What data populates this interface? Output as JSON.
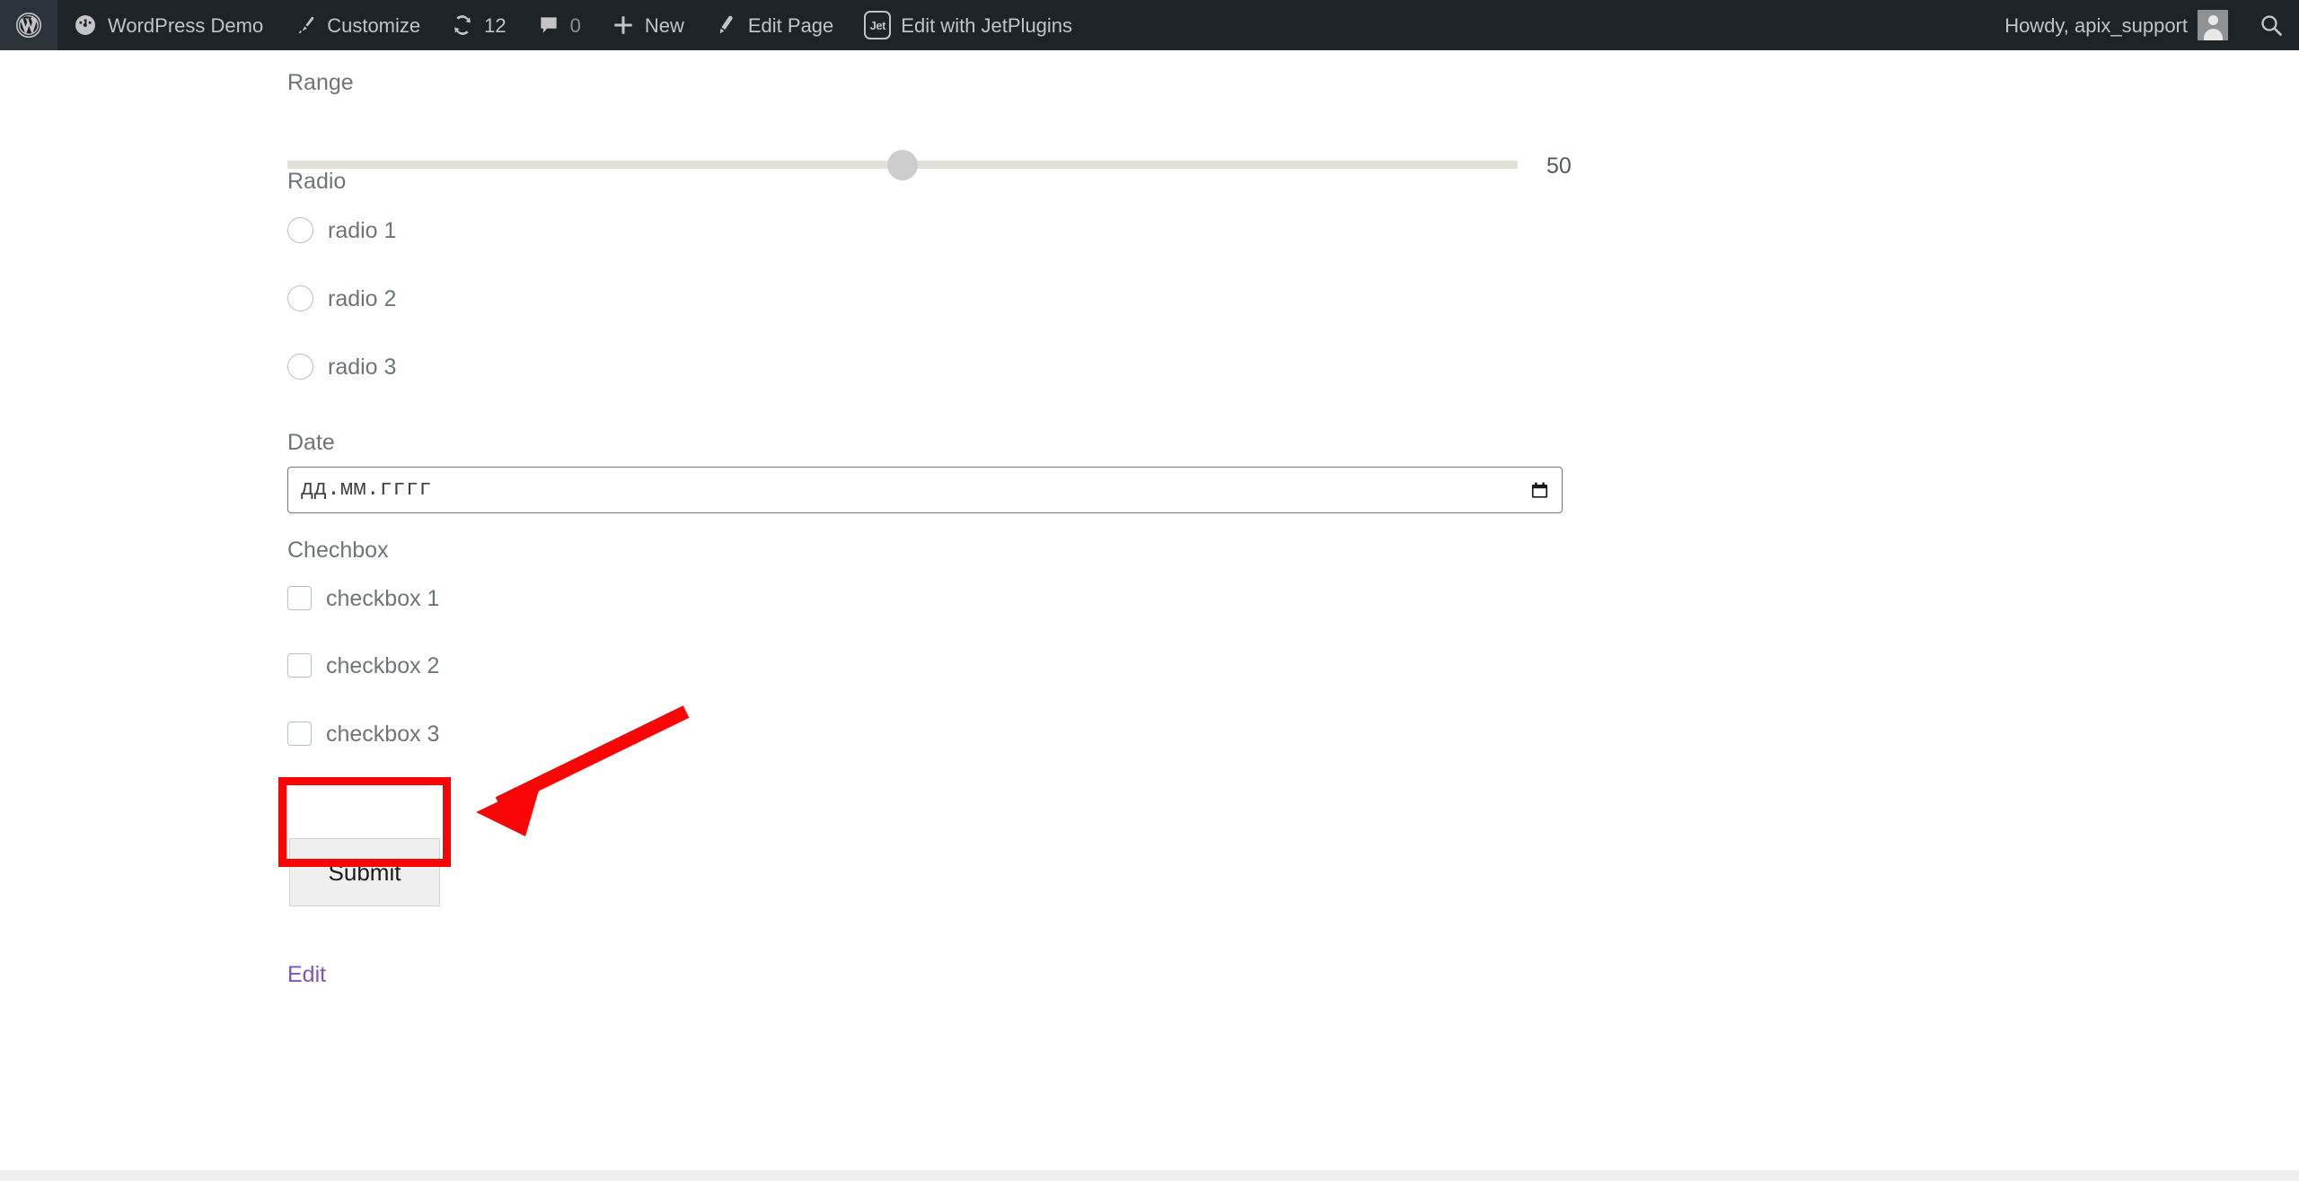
{
  "adminbar": {
    "wp_logo_label": "wordpress-logo",
    "site_name": "WordPress Demo",
    "customize": "Customize",
    "updates_count": "12",
    "comments_count": "0",
    "new": "New",
    "edit_page": "Edit Page",
    "jetplugins_badge": "Jet",
    "edit_with_jetplugins": "Edit with JetPlugins",
    "howdy": "Howdy, apix_support",
    "search_label": "search-icon",
    "bg_color": "#1d2327",
    "text_color": "#c3c4c7"
  },
  "form": {
    "range": {
      "label": "Range",
      "value": "50",
      "min": 0,
      "max": 100,
      "percent": 50,
      "track_color": "#e3e0da",
      "thumb_color": "#cdcdcd"
    },
    "radio": {
      "label": "Radio",
      "options": [
        {
          "label": "radio 1",
          "checked": false
        },
        {
          "label": "radio 2",
          "checked": false
        },
        {
          "label": "radio 3",
          "checked": false
        }
      ]
    },
    "date": {
      "label": "Date",
      "placeholder": "дд.мм.гггг",
      "value": "",
      "icon": "calendar-icon"
    },
    "checkbox": {
      "label": "Chechbox",
      "options": [
        {
          "label": "checkbox 1",
          "checked": false
        },
        {
          "label": "checkbox 2",
          "checked": false
        },
        {
          "label": "checkbox 3",
          "checked": false
        }
      ]
    },
    "submit_label": "Submit",
    "edit_link": "Edit",
    "link_color": "#7f54b3"
  },
  "annotation": {
    "color": "#fa0505",
    "shape": "arrow-pointing-to-submit-button",
    "target": "Submit"
  }
}
